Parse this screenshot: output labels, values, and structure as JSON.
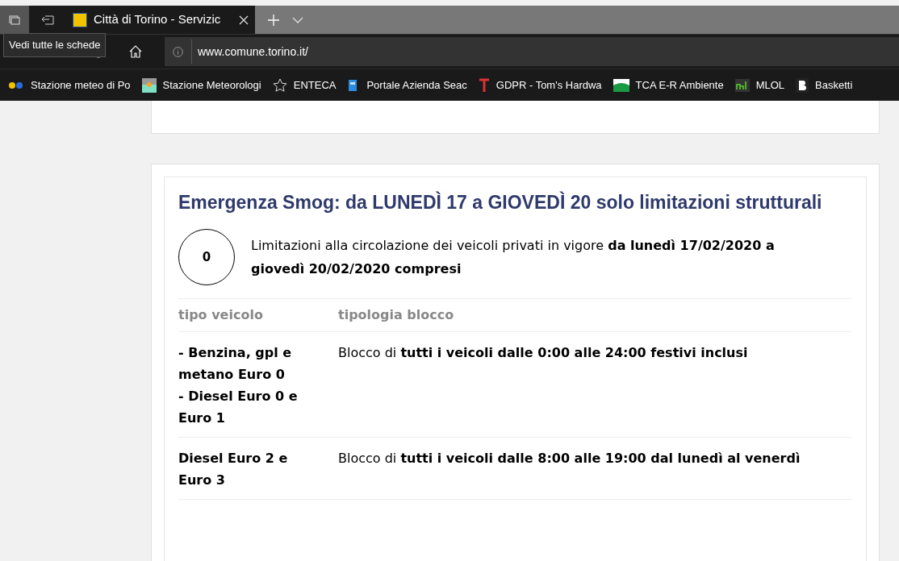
{
  "browser": {
    "tab": {
      "title": "Città di Torino - Servizic",
      "selected": true
    },
    "tooltip": "Vedi tutte le schede",
    "address": "www.comune.torino.it/",
    "bookmarks": [
      {
        "label": "Stazione meteo di Po",
        "kind": "dots"
      },
      {
        "label": "Stazione Meteorologi",
        "kind": "landscape"
      },
      {
        "label": "ENTECA",
        "kind": "star"
      },
      {
        "label": "Portale Azienda Seac",
        "kind": "book"
      },
      {
        "label": "GDPR - Tom's Hardwa",
        "kind": "t"
      },
      {
        "label": "TCA E-R Ambiente",
        "kind": "flag"
      },
      {
        "label": "MLOL",
        "kind": "ml"
      },
      {
        "label": "Basketti",
        "kind": "b"
      }
    ]
  },
  "article": {
    "title": "Emergenza Smog: da LUNEDÌ 17 a GIOVEDÌ 20 solo limitazioni strutturali",
    "level_badge": "0",
    "intro": "Limitazioni alla circolazione dei veicoli privati in vigore **da lunedì 17/02/2020 a giovedì 20/02/2020 compresi**",
    "table": {
      "columns": [
        "tipo veicolo",
        "tipologia blocco"
      ],
      "rows": [
        {
          "vehicle": [
            "- Benzina, gpl e metano Euro 0",
            "- Diesel Euro 0 e Euro 1"
          ],
          "block": "Blocco di **tutti i veicoli dalle 0:00 alle 24:00 festivi inclusi**"
        },
        {
          "vehicle": [
            "Diesel Euro 2 e Euro 3"
          ],
          "block": "Blocco di **tutti i veicoli dalle 8:00 alle 19:00 dal lunedì al venerdì**"
        }
      ]
    }
  }
}
